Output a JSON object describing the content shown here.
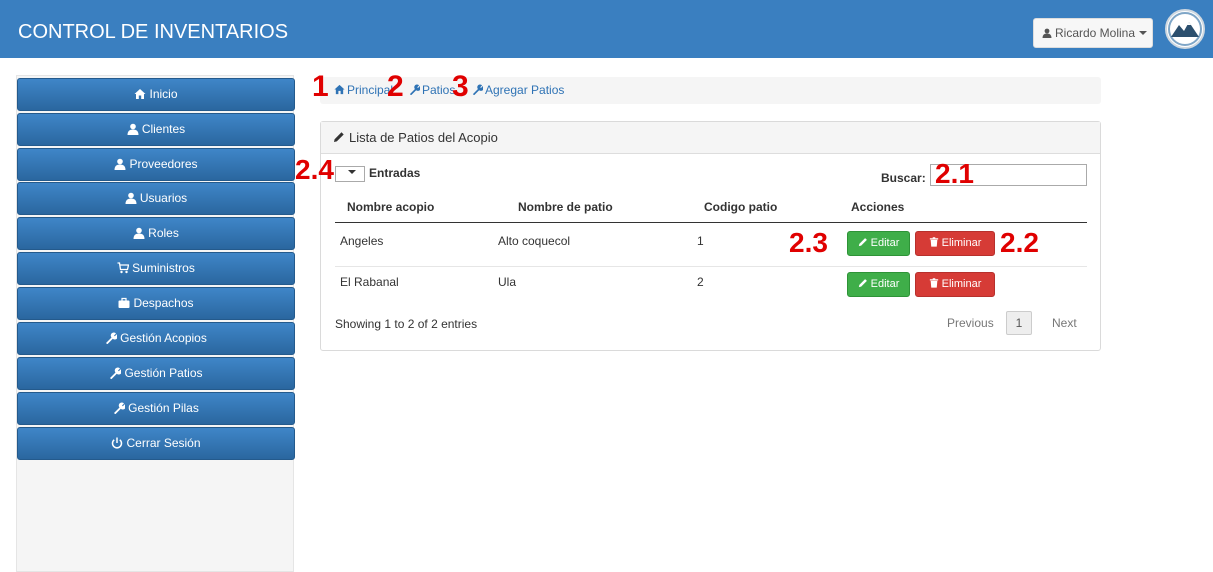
{
  "header": {
    "title": "CONTROL DE INVENTARIOS",
    "user_name": "Ricardo Molina"
  },
  "sidebar": {
    "items": [
      {
        "label": "Inicio",
        "icon": "home-icon"
      },
      {
        "label": "Clientes",
        "icon": "user-icon"
      },
      {
        "label": "Proveedores",
        "icon": "user-icon"
      },
      {
        "label": "Usuarios",
        "icon": "user-icon"
      },
      {
        "label": "Roles",
        "icon": "user-icon"
      },
      {
        "label": "Suministros",
        "icon": "cart-icon"
      },
      {
        "label": "Despachos",
        "icon": "briefcase-icon"
      },
      {
        "label": "Gestión Acopios",
        "icon": "wrench-icon"
      },
      {
        "label": "Gestión Patios",
        "icon": "wrench-icon"
      },
      {
        "label": "Gestión Pilas",
        "icon": "wrench-icon"
      },
      {
        "label": "Cerrar Sesión",
        "icon": "power-icon"
      }
    ]
  },
  "breadcrumb": {
    "items": [
      "Principal",
      "Patios",
      "Agregar Patios"
    ]
  },
  "annotations": {
    "a1": "1",
    "a2": "2",
    "a3": "3",
    "a24": "2.4",
    "a21": "2.1",
    "a23": "2.3",
    "a22": "2.2"
  },
  "panel": {
    "title": "Lista de Patios del Acopio",
    "entries_label": "Entradas",
    "search_label": "Buscar:",
    "columns": [
      "Nombre acopio",
      "Nombre de patio",
      "Codigo patio",
      "Acciones"
    ],
    "rows": [
      {
        "acopio": "Angeles",
        "patio": "Alto coquecol",
        "codigo": "1"
      },
      {
        "acopio": "El Rabanal",
        "patio": "Ula",
        "codigo": "2"
      }
    ],
    "edit_label": "Editar",
    "delete_label": "Eliminar",
    "showing": "Showing 1 to 2 of 2 entries",
    "pagination": {
      "previous": "Previous",
      "current": "1",
      "next": "Next"
    }
  },
  "colors": {
    "navbar": "#3a7fc0",
    "sidebar_button": "#2f73b5",
    "annotation": "#e00000",
    "edit": "#3fae49",
    "delete": "#d63b36"
  }
}
